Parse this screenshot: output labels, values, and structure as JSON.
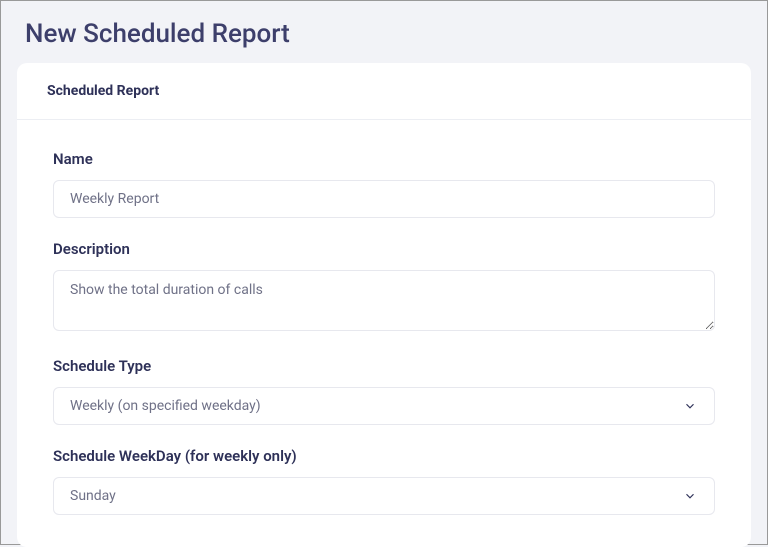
{
  "page": {
    "title": "New Scheduled Report"
  },
  "card": {
    "header": "Scheduled Report"
  },
  "form": {
    "name": {
      "label": "Name",
      "value": "Weekly Report"
    },
    "description": {
      "label": "Description",
      "value": "Show the total duration of calls"
    },
    "schedule_type": {
      "label": "Schedule Type",
      "value": "Weekly (on specified weekday)"
    },
    "schedule_weekday": {
      "label": "Schedule WeekDay (for weekly only)",
      "value": "Sunday"
    }
  }
}
